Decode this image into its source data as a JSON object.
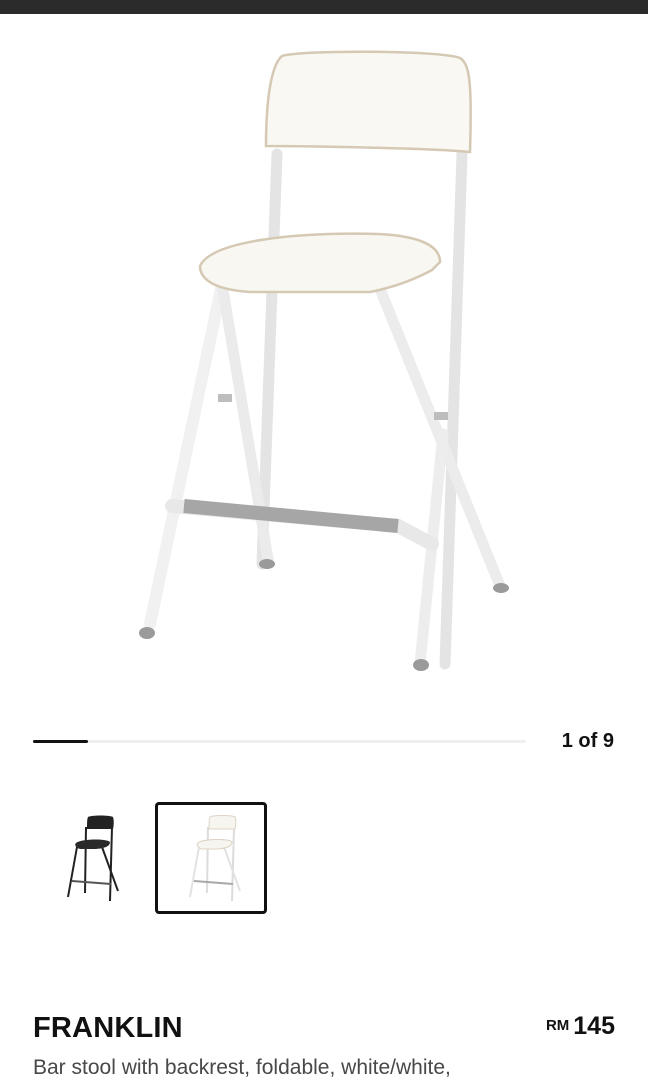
{
  "gallery": {
    "current_index": 1,
    "total": 9,
    "counter_label": "1 of 9",
    "progress_fraction": 0.111,
    "thumbnails": [
      {
        "name": "black-bar-stool",
        "selected": false
      },
      {
        "name": "white-bar-stool",
        "selected": true
      }
    ]
  },
  "product": {
    "name": "FRANKLIN",
    "currency": "RM",
    "price": "145",
    "description": "Bar stool with backrest, foldable, white/white,"
  },
  "colors": {
    "top_bar": "#2b2b2b",
    "text_primary": "#111111",
    "text_secondary": "#484848",
    "progress_track": "#efefef"
  }
}
